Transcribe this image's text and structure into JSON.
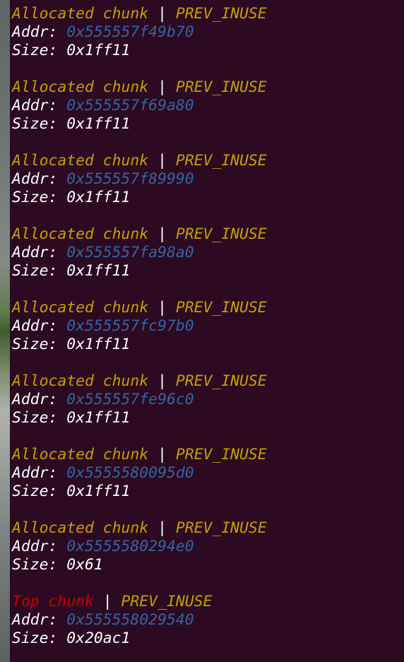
{
  "separator": " | ",
  "addr_label": "Addr: ",
  "size_label": "Size: ",
  "colors": {
    "background": "#2c0a22",
    "status": "#c4a000",
    "top_chunk": "#cc0000",
    "address": "#3465a4",
    "text": "#ffffff"
  },
  "chunks": [
    {
      "title": "Allocated chunk",
      "flag": "PREV_INUSE",
      "addr": "0x555557f49b70",
      "size": "0x1ff11"
    },
    {
      "title": "Allocated chunk",
      "flag": "PREV_INUSE",
      "addr": "0x555557f69a80",
      "size": "0x1ff11"
    },
    {
      "title": "Allocated chunk",
      "flag": "PREV_INUSE",
      "addr": "0x555557f89990",
      "size": "0x1ff11"
    },
    {
      "title": "Allocated chunk",
      "flag": "PREV_INUSE",
      "addr": "0x555557fa98a0",
      "size": "0x1ff11"
    },
    {
      "title": "Allocated chunk",
      "flag": "PREV_INUSE",
      "addr": "0x555557fc97b0",
      "size": "0x1ff11"
    },
    {
      "title": "Allocated chunk",
      "flag": "PREV_INUSE",
      "addr": "0x555557fe96c0",
      "size": "0x1ff11"
    },
    {
      "title": "Allocated chunk",
      "flag": "PREV_INUSE",
      "addr": "0x5555580095d0",
      "size": "0x1ff11"
    },
    {
      "title": "Allocated chunk",
      "flag": "PREV_INUSE",
      "addr": "0x5555580294e0",
      "size": "0x61"
    },
    {
      "title": "Top chunk",
      "flag": "PREV_INUSE",
      "addr": "0x555558029540",
      "size": "0x20ac1"
    }
  ]
}
